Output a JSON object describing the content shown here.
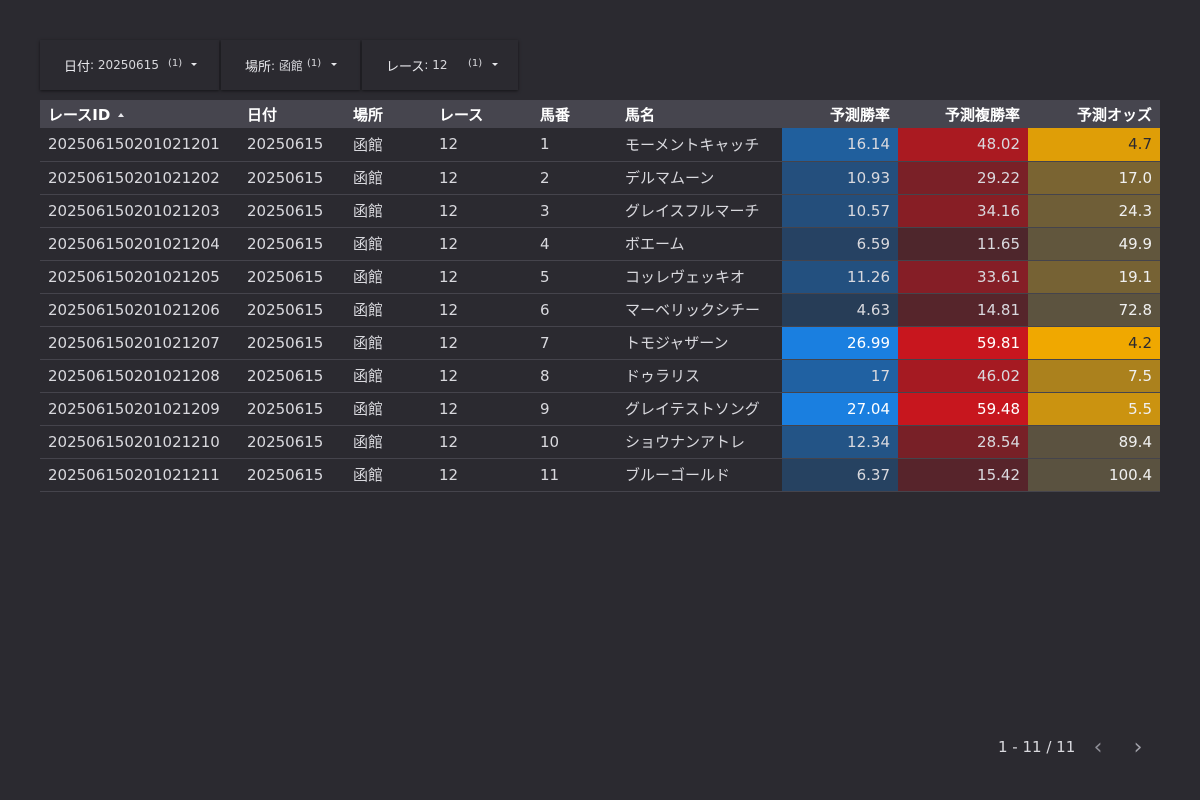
{
  "filters": [
    {
      "label": "日付",
      "value": ": 20250615",
      "count": "(1)"
    },
    {
      "label": "場所",
      "value": ": 函館",
      "count": "(1)"
    },
    {
      "label": "レース",
      "value": ": 12",
      "count": "(1)"
    }
  ],
  "table": {
    "columns": [
      "レースID",
      "日付",
      "場所",
      "レース",
      "馬番",
      "馬名",
      "予測勝率",
      "予測複勝率",
      "予測オッズ"
    ],
    "rows": [
      [
        "202506150201021201",
        "20250615",
        "函館",
        "12",
        "1",
        "モーメントキャッチ",
        "16.14",
        "48.02",
        "4.7"
      ],
      [
        "202506150201021202",
        "20250615",
        "函館",
        "12",
        "2",
        "デルマムーン",
        "10.93",
        "29.22",
        "17.0"
      ],
      [
        "202506150201021203",
        "20250615",
        "函館",
        "12",
        "3",
        "グレイスフルマーチ",
        "10.57",
        "34.16",
        "24.3"
      ],
      [
        "202506150201021204",
        "20250615",
        "函館",
        "12",
        "4",
        "ボエーム",
        "6.59",
        "11.65",
        "49.9"
      ],
      [
        "202506150201021205",
        "20250615",
        "函館",
        "12",
        "5",
        "コッレヴェッキオ",
        "11.26",
        "33.61",
        "19.1"
      ],
      [
        "202506150201021206",
        "20250615",
        "函館",
        "12",
        "6",
        "マーベリックシチー",
        "4.63",
        "14.81",
        "72.8"
      ],
      [
        "202506150201021207",
        "20250615",
        "函館",
        "12",
        "7",
        "トモジャザーン",
        "26.99",
        "59.81",
        "4.2"
      ],
      [
        "202506150201021208",
        "20250615",
        "函館",
        "12",
        "8",
        "ドゥラリス",
        "17",
        "46.02",
        "7.5"
      ],
      [
        "202506150201021209",
        "20250615",
        "函館",
        "12",
        "9",
        "グレイテストソング",
        "27.04",
        "59.48",
        "5.5"
      ],
      [
        "202506150201021210",
        "20250615",
        "函館",
        "12",
        "10",
        "ショウナンアトレ",
        "12.34",
        "28.54",
        "89.4"
      ],
      [
        "202506150201021211",
        "20250615",
        "函館",
        "12",
        "11",
        "ブルーゴールド",
        "6.37",
        "15.42",
        "100.4"
      ]
    ]
  },
  "heat_colors": {
    "win": {
      "base": "#2b2a30",
      "max": "#1a7fe0"
    },
    "place": {
      "base": "#2b2a30",
      "max": "#c8161e"
    },
    "odds": {
      "base": "#5a5240",
      "max": "#f0a800"
    }
  },
  "pagination": {
    "label": "1 - 11 / 11",
    "prev": "‹",
    "next": "›"
  }
}
